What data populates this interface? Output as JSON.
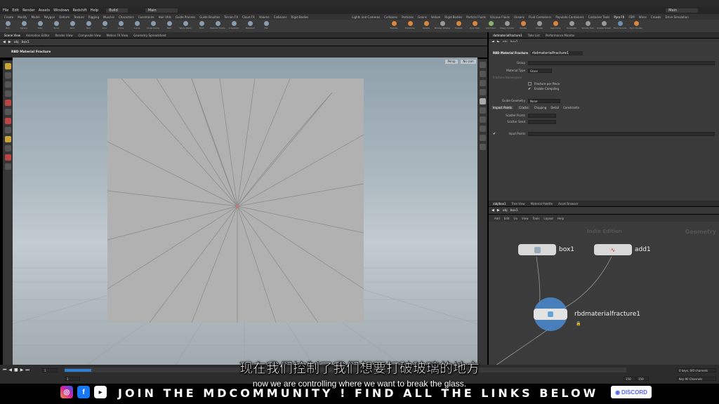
{
  "menu": [
    "File",
    "Edit",
    "Render",
    "Assets",
    "Windows",
    "Redshift",
    "Help"
  ],
  "build_label": "Build",
  "desktop_label": "Main",
  "right_desktop_label": "Main",
  "shelf_tabs_left": [
    "Create",
    "Modify",
    "Model",
    "Polygon",
    "Deform",
    "Texture",
    "Rigging",
    "Muscles",
    "Characters",
    "Constraints",
    "Hair Utils",
    "Guide Process",
    "Guide Brushes",
    "Terrain FX",
    "Cloud FX",
    "Volume",
    "Collisions",
    "Rigid Bodies"
  ],
  "shelf_tabs_right": [
    "Lights and Cameras",
    "Collisions",
    "Particles",
    "Grains",
    "Vellum",
    "Rigid Bodies",
    "Particle Fluids",
    "Viscous Fluids",
    "Oceans",
    "Fluid Containers",
    "Populate Containers",
    "Container Tools",
    "Pyro FX",
    "FEM",
    "Wires",
    "Crowds",
    "Drive Simulation"
  ],
  "tools_left": [
    "Box",
    "Sphere",
    "Tube",
    "Torus",
    "Grid",
    "Null",
    "Line",
    "Circle",
    "Curve",
    "Draw Curve",
    "Path",
    "Spray Paint",
    "Font",
    "Platonic Solids",
    "L-System",
    "Metaball",
    "File"
  ],
  "tools_right": [
    "Flames",
    "Explosion",
    "Sparks",
    "Billowy Smoke",
    "Fireball",
    "Pyro Trail",
    "Add Color",
    "Wispy Smoke",
    "Candle",
    "Smoke",
    "Gas Cone",
    "Dissipate",
    "Smoke Trail",
    "Smoke Solver",
    "Fluid Source",
    "Pyro Cluster"
  ],
  "left_pane_tabs": [
    "Scene View",
    "Animation Editor",
    "Render View",
    "Composite View",
    "Motion FX View",
    "Geometry Spreadsheet"
  ],
  "right_pane_tabs": [
    "rbdmaterialfracture1",
    "Take List",
    "Performance Monitor"
  ],
  "left_path": {
    "obj": "obj",
    "node": "box1"
  },
  "viewport_title": "RBD Material Fracture",
  "viewport_persp": "Persp",
  "viewport_cam": "No cam",
  "params": {
    "node_type": "RBD Material Fracture",
    "node_name": "rbdmaterialfracture1",
    "group_label": "Group",
    "material_type_label": "Material Type",
    "material_type_value": "Glass",
    "fracture_namespace_label": "Fracture Namespace",
    "fracture_per_piece": "Fracture per Piece",
    "enable_compiling": "Enable Compiling",
    "guide_geometry_label": "Guide Geometry",
    "guide_geometry_value": "None",
    "tabs": [
      "Impact Points",
      "Cracks",
      "Chipping",
      "Detail",
      "Constraints"
    ],
    "scatter_points": "Scatter Points",
    "scatter_seed": "Scatter Seed",
    "input_points": "Input Points"
  },
  "network": {
    "tabs": [
      "/obj/box1",
      "Tree View",
      "Material Palette",
      "Asset Browser"
    ],
    "path": {
      "obj": "obj",
      "node": "box1"
    },
    "menu": [
      "Add",
      "Edit",
      "Go",
      "View",
      "Tools",
      "Layout",
      "Help"
    ],
    "watermark_center": "Indie Edition",
    "watermark_right": "Geometry",
    "nodes": [
      "box1",
      "add1",
      "rbdmaterialfracture1"
    ]
  },
  "timeline": {
    "frame": "1",
    "start": "1",
    "end_a": "150",
    "end_b": "150",
    "keys": "0 keys, 0/0 channels",
    "key_all": "Key All Channels"
  },
  "subtitle_cn": "现在我们控制了我们想要打破玻璃的地方",
  "subtitle_en": "now we are controlling where we want to break the glass.",
  "banner": "JOIN THE MDCOMMUNITY ! FIND ALL THE LINKS BELOW",
  "discord_label": "DISCORD",
  "colors": {
    "accent": "#e8c15a",
    "instagram": "#d6249f",
    "facebook": "#1877f2",
    "discord": "#5865f2"
  }
}
